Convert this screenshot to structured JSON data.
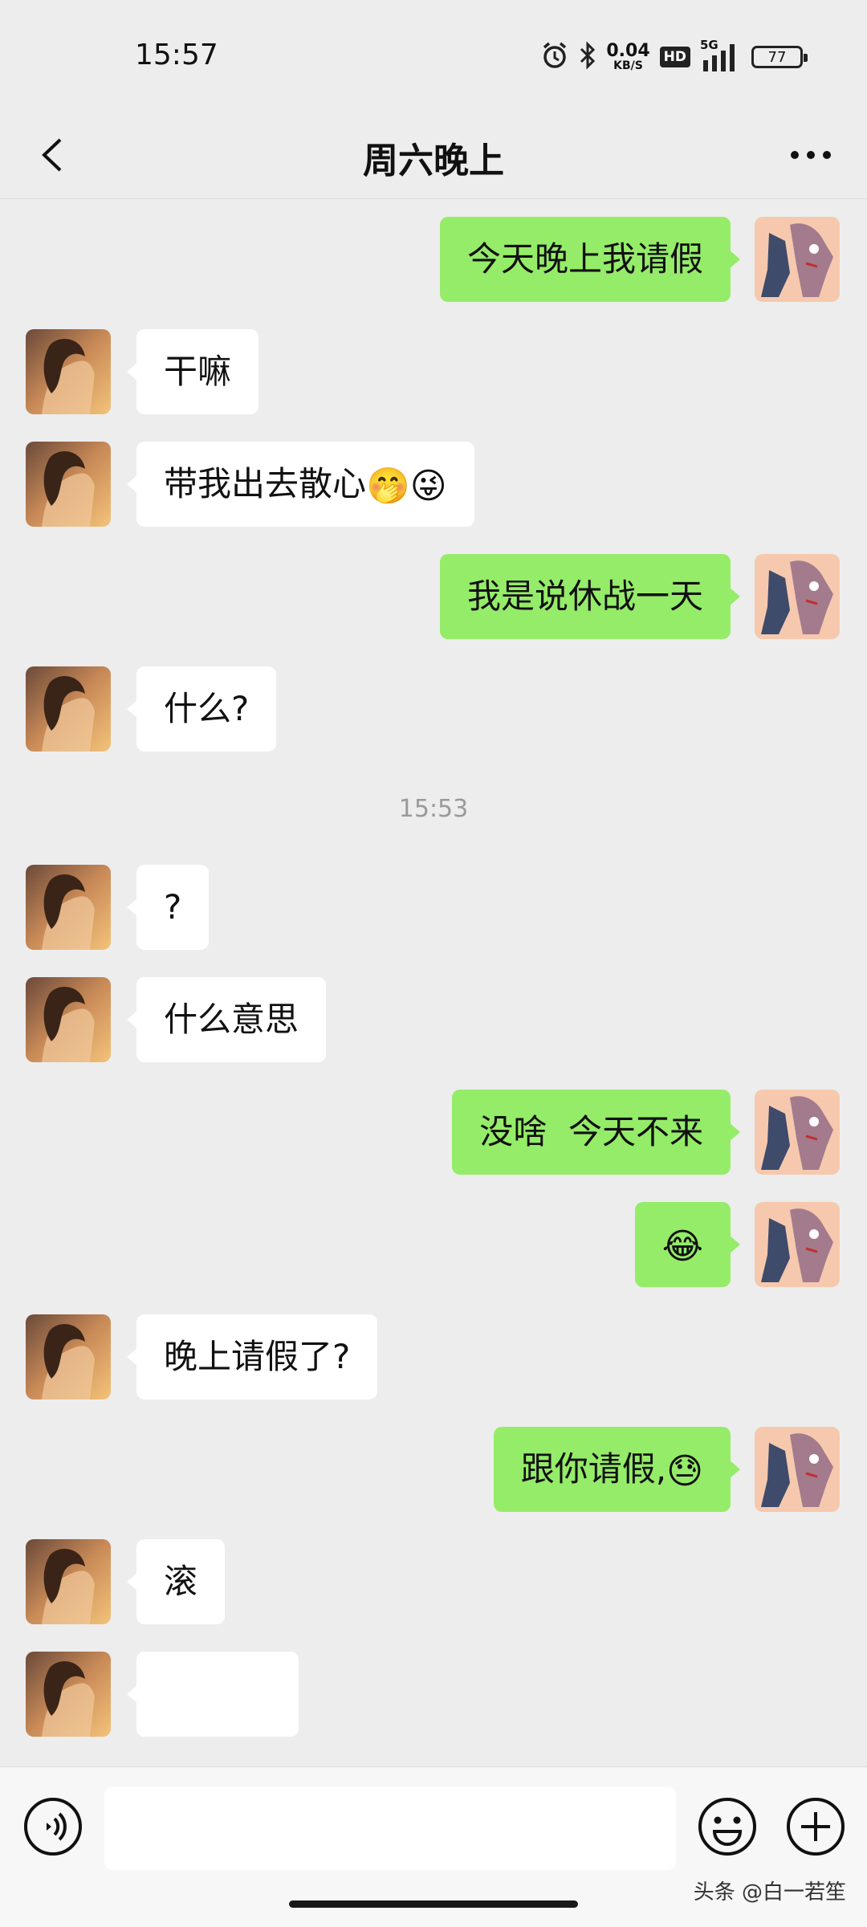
{
  "status_bar": {
    "time": "15:57",
    "net_speed": "0.04",
    "net_unit": "KB/S",
    "hd": "HD",
    "signal": "5G",
    "battery": "77",
    "icons": [
      "alarm-icon",
      "bluetooth-icon",
      "signal-icon",
      "battery-icon"
    ]
  },
  "header": {
    "title": "周六晚上",
    "back_icon": "chevron-left-icon",
    "more_icon": "more-dots-icon"
  },
  "messages": [
    {
      "side": "right",
      "text": "今天晚上我请假"
    },
    {
      "side": "left",
      "text": "干嘛"
    },
    {
      "side": "left",
      "text": "带我出去散心",
      "emoji": "🤭😜"
    },
    {
      "side": "right",
      "text": "我是说休战一天"
    },
    {
      "side": "left",
      "text": "什么?"
    },
    {
      "side": "left",
      "text": "?"
    },
    {
      "side": "left",
      "text": "什么意思"
    },
    {
      "side": "right",
      "text": "没啥  今天不来"
    },
    {
      "side": "right",
      "text": "",
      "emoji": "😂"
    },
    {
      "side": "left",
      "text": "晚上请假了?"
    },
    {
      "side": "right",
      "text": "跟你请假,",
      "emoji": "😓"
    },
    {
      "side": "left",
      "text": "滚"
    },
    {
      "side": "left",
      "text": ""
    }
  ],
  "timestamp": "15:53",
  "input": {
    "value": "",
    "voice_icon": "voice-icon",
    "emoji_icon": "smiley-icon",
    "plus_icon": "plus-icon"
  },
  "watermark": "头条 @白一若笙",
  "colors": {
    "background": "#ededed",
    "sent_bubble": "#95ec69",
    "received_bubble": "#ffffff"
  }
}
